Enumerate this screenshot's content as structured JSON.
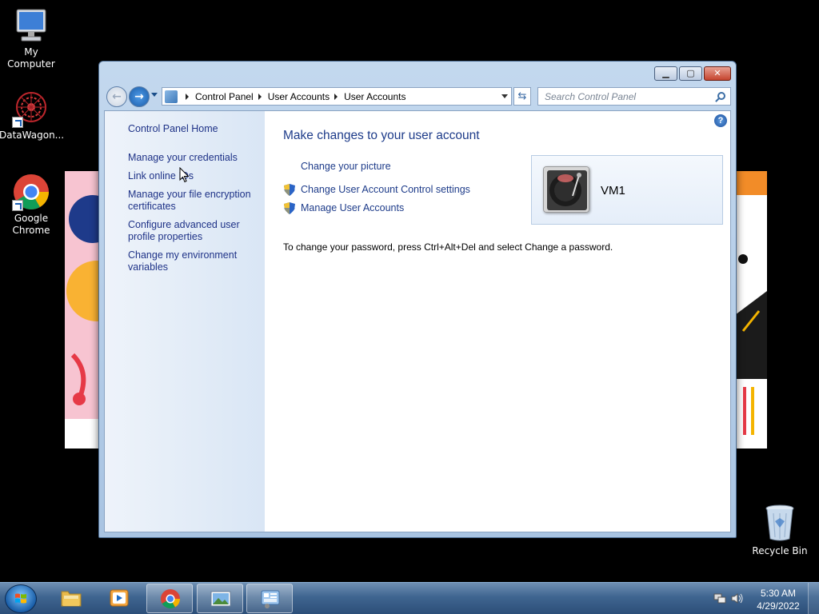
{
  "desktop": {
    "icons": [
      {
        "label": "My Computer",
        "icon": "computer-icon"
      },
      {
        "label": "DataWagon...",
        "icon": "datawagon-icon"
      },
      {
        "label": "Google Chrome",
        "icon": "chrome-icon"
      },
      {
        "label": "Recycle Bin",
        "icon": "recycle-bin-icon"
      }
    ]
  },
  "window": {
    "buttons": {
      "minimize": "▁",
      "maximize": "▢",
      "close": "✕"
    },
    "address": {
      "crumbs": [
        "Control Panel",
        "User Accounts",
        "User Accounts"
      ]
    },
    "search_placeholder": "Search Control Panel",
    "help": "?",
    "left_pane": {
      "home": "Control Panel Home",
      "links": [
        "Manage your credentials",
        "Link online IDs",
        "Manage your file encryption certificates",
        "Configure advanced user profile properties",
        "Change my environment variables"
      ]
    },
    "main": {
      "title": "Make changes to your user account",
      "tasks": [
        {
          "label": "Change your picture",
          "shield": false
        },
        {
          "label": "Change User Account Control settings",
          "shield": true
        },
        {
          "label": "Manage User Accounts",
          "shield": true
        }
      ],
      "password_note": "To change your password, press Ctrl+Alt+Del and select Change a password.",
      "account": {
        "name": "VM1"
      }
    }
  },
  "taskbar": {
    "items": [
      {
        "name": "explorer",
        "icon": "folder-icon"
      },
      {
        "name": "media-player",
        "icon": "media-player-icon"
      },
      {
        "name": "chrome",
        "icon": "chrome-icon"
      },
      {
        "name": "photo-viewer",
        "icon": "photo-viewer-icon"
      },
      {
        "name": "control-panel",
        "icon": "control-panel-icon"
      }
    ],
    "clock": {
      "time": "5:30 AM",
      "date": "4/29/2022"
    }
  },
  "colors": {
    "link": "#1e3287",
    "title": "#1e3c8a",
    "taskbar": "#3f6590"
  }
}
